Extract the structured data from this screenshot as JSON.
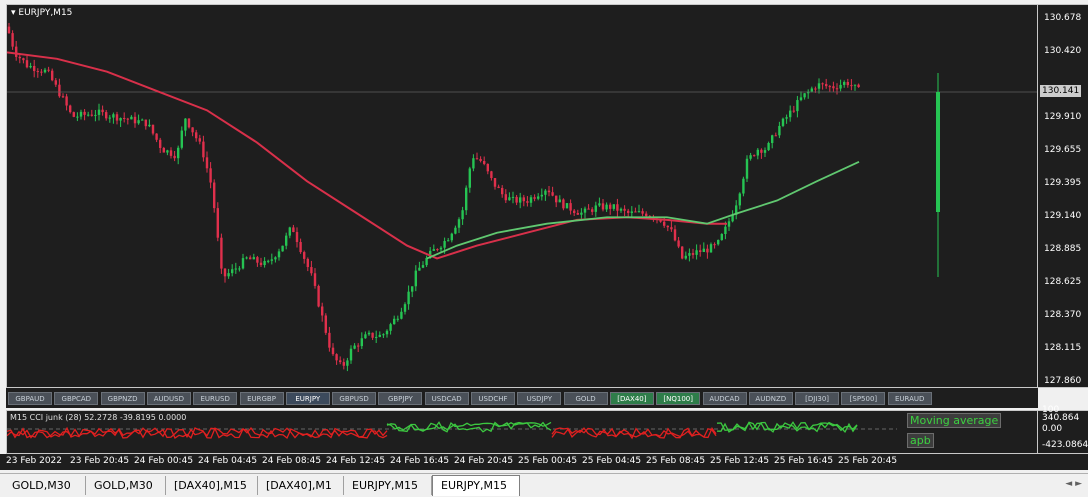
{
  "chart": {
    "title": "EURJPY,M15",
    "current_price": "130.141",
    "colors": {
      "bull": "#26c453",
      "bear": "#e0304c",
      "ma_red": "#d8304a",
      "ma_green": "#60c870",
      "bg": "#1e1e1e"
    }
  },
  "price_axis": [
    "130.678",
    "130.420",
    "129.910",
    "129.655",
    "129.395",
    "129.140",
    "128.885",
    "128.625",
    "128.370",
    "128.115",
    "127.860"
  ],
  "time_axis": [
    "23 Feb 2022",
    "23 Feb 20:45",
    "24 Feb 00:45",
    "24 Feb 04:45",
    "24 Feb 08:45",
    "24 Feb 12:45",
    "24 Feb 16:45",
    "24 Feb 20:45",
    "25 Feb 00:45",
    "25 Feb 04:45",
    "25 Feb 08:45",
    "25 Feb 12:45",
    "25 Feb 16:45",
    "25 Feb 20:45"
  ],
  "symbols": [
    {
      "label": "GBPAUD",
      "state": ""
    },
    {
      "label": "GBPCAD",
      "state": ""
    },
    {
      "label": "GBPNZD",
      "state": ""
    },
    {
      "label": "AUDUSD",
      "state": ""
    },
    {
      "label": "EURUSD",
      "state": ""
    },
    {
      "label": "EURGBP",
      "state": ""
    },
    {
      "label": "EURJPY",
      "state": "active"
    },
    {
      "label": "GBPUSD",
      "state": ""
    },
    {
      "label": "GBPJPY",
      "state": ""
    },
    {
      "label": "USDCAD",
      "state": ""
    },
    {
      "label": "USDCHF",
      "state": ""
    },
    {
      "label": "USDJPY",
      "state": ""
    },
    {
      "label": "GOLD",
      "state": ""
    },
    {
      "label": "[DAX40]",
      "state": "green"
    },
    {
      "label": "[NQ100]",
      "state": "green"
    },
    {
      "label": "AUDCAD",
      "state": ""
    },
    {
      "label": "AUDNZD",
      "state": ""
    },
    {
      "label": "[DJI30]",
      "state": ""
    },
    {
      "label": "[SP500]",
      "state": ""
    },
    {
      "label": "EURAUD",
      "state": ""
    }
  ],
  "indicator": {
    "title": "M15  CCI junk (28) 52.2728 -39.8195 0.0000",
    "axis": [
      "340.864",
      "0.00",
      "-423.0864"
    ],
    "axis_top": "100",
    "buttons": [
      "Moving average",
      "apb"
    ]
  },
  "tabs": [
    {
      "label": "GOLD,M30",
      "active": false
    },
    {
      "label": "GOLD,M30",
      "active": false
    },
    {
      "label": "[DAX40],M15",
      "active": false
    },
    {
      "label": "[DAX40],M1",
      "active": false
    },
    {
      "label": "EURJPY,M15",
      "active": false
    },
    {
      "label": "EURJPY,M15",
      "active": true
    }
  ],
  "tab_scroll": "◄ ►"
}
